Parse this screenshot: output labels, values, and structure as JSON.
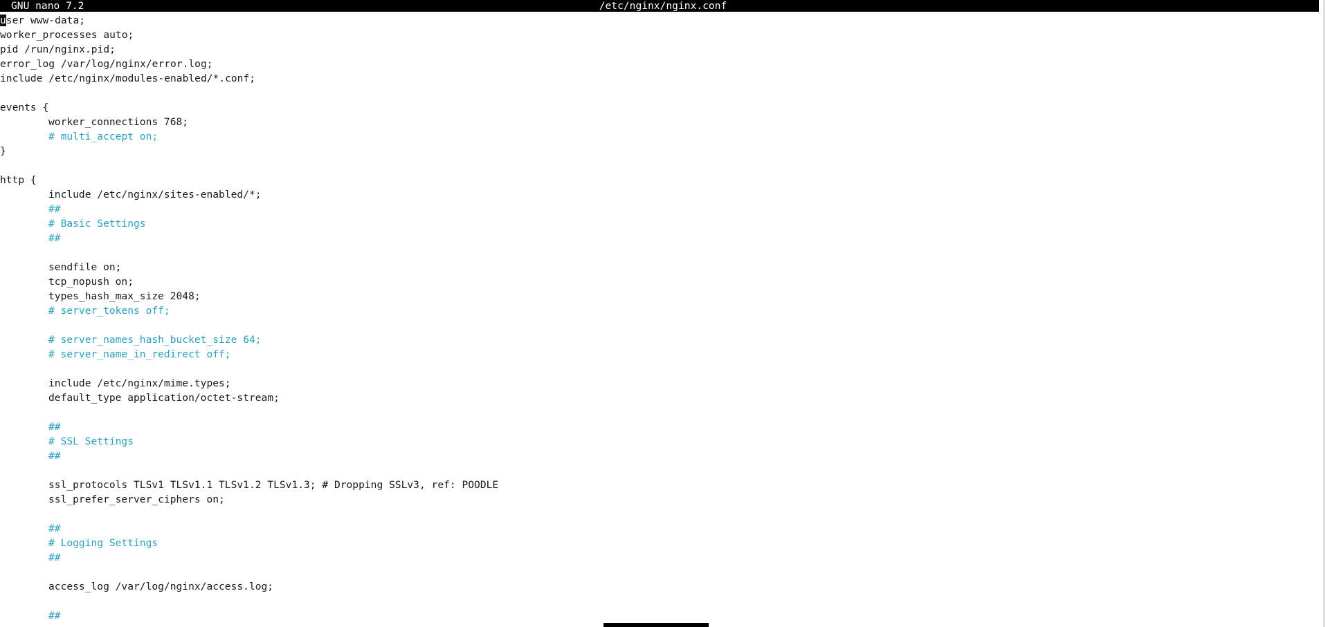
{
  "titlebar": {
    "app_name": "GNU nano 7.2",
    "file_name": "/etc/nginx/nginx.conf"
  },
  "editor": {
    "cursor_char": "u",
    "first_line_rest": "ser www-data;",
    "lines": [
      {
        "indent": false,
        "comment": false,
        "text": "worker_processes auto;"
      },
      {
        "indent": false,
        "comment": false,
        "text": "pid /run/nginx.pid;"
      },
      {
        "indent": false,
        "comment": false,
        "text": "error_log /var/log/nginx/error.log;"
      },
      {
        "indent": false,
        "comment": false,
        "text": "include /etc/nginx/modules-enabled/*.conf;"
      },
      {
        "indent": false,
        "comment": false,
        "text": ""
      },
      {
        "indent": false,
        "comment": false,
        "text": "events {"
      },
      {
        "indent": true,
        "comment": false,
        "text": "worker_connections 768;"
      },
      {
        "indent": true,
        "comment": true,
        "text": "# multi_accept on;"
      },
      {
        "indent": false,
        "comment": false,
        "text": "}"
      },
      {
        "indent": false,
        "comment": false,
        "text": ""
      },
      {
        "indent": false,
        "comment": false,
        "text": "http {"
      },
      {
        "indent": true,
        "comment": false,
        "text": "include /etc/nginx/sites-enabled/*;"
      },
      {
        "indent": true,
        "comment": true,
        "text": "##"
      },
      {
        "indent": true,
        "comment": true,
        "text": "# Basic Settings"
      },
      {
        "indent": true,
        "comment": true,
        "text": "##"
      },
      {
        "indent": false,
        "comment": false,
        "text": ""
      },
      {
        "indent": true,
        "comment": false,
        "text": "sendfile on;"
      },
      {
        "indent": true,
        "comment": false,
        "text": "tcp_nopush on;"
      },
      {
        "indent": true,
        "comment": false,
        "text": "types_hash_max_size 2048;"
      },
      {
        "indent": true,
        "comment": true,
        "text": "# server_tokens off;"
      },
      {
        "indent": false,
        "comment": false,
        "text": ""
      },
      {
        "indent": true,
        "comment": true,
        "text": "# server_names_hash_bucket_size 64;"
      },
      {
        "indent": true,
        "comment": true,
        "text": "# server_name_in_redirect off;"
      },
      {
        "indent": false,
        "comment": false,
        "text": ""
      },
      {
        "indent": true,
        "comment": false,
        "text": "include /etc/nginx/mime.types;"
      },
      {
        "indent": true,
        "comment": false,
        "text": "default_type application/octet-stream;"
      },
      {
        "indent": false,
        "comment": false,
        "text": ""
      },
      {
        "indent": true,
        "comment": true,
        "text": "##"
      },
      {
        "indent": true,
        "comment": true,
        "text": "# SSL Settings"
      },
      {
        "indent": true,
        "comment": true,
        "text": "##"
      },
      {
        "indent": false,
        "comment": false,
        "text": ""
      },
      {
        "indent": true,
        "comment": false,
        "text": "ssl_protocols TLSv1 TLSv1.1 TLSv1.2 TLSv1.3; # Dropping SSLv3, ref: POODLE"
      },
      {
        "indent": true,
        "comment": false,
        "text": "ssl_prefer_server_ciphers on;"
      },
      {
        "indent": false,
        "comment": false,
        "text": ""
      },
      {
        "indent": true,
        "comment": true,
        "text": "##"
      },
      {
        "indent": true,
        "comment": true,
        "text": "# Logging Settings"
      },
      {
        "indent": true,
        "comment": true,
        "text": "##"
      },
      {
        "indent": false,
        "comment": false,
        "text": ""
      },
      {
        "indent": true,
        "comment": false,
        "text": "access_log /var/log/nginx/access.log;"
      },
      {
        "indent": false,
        "comment": false,
        "text": ""
      },
      {
        "indent": true,
        "comment": true,
        "text": "##"
      }
    ]
  },
  "colors": {
    "comment": "#2aa1c0",
    "titlebar_bg": "#000000",
    "titlebar_fg": "#ffffff"
  }
}
